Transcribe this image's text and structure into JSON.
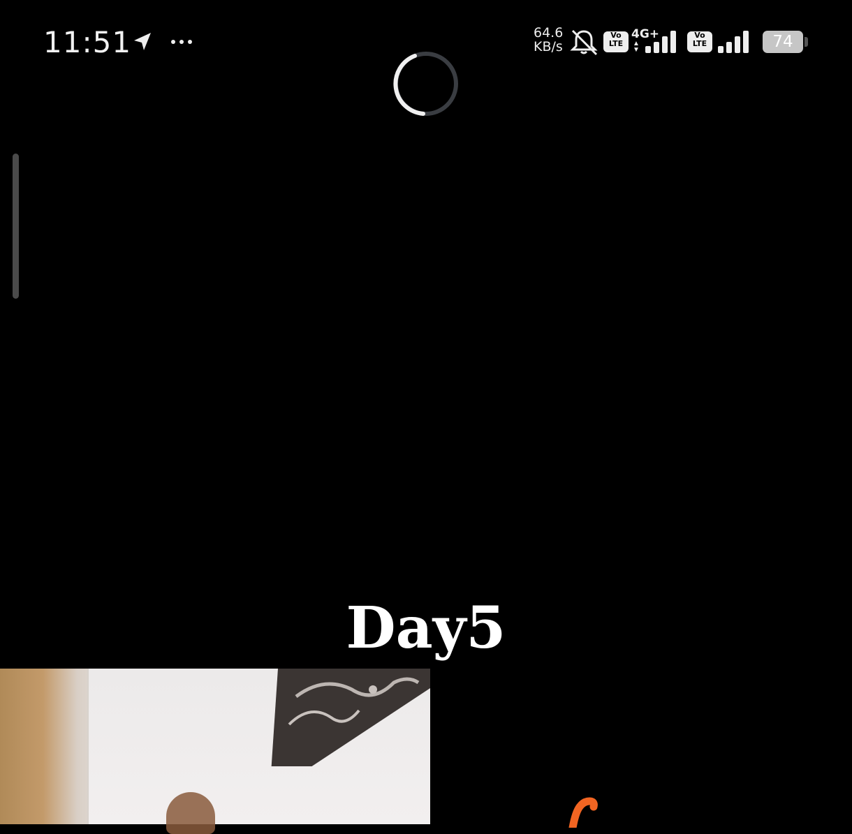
{
  "status_bar": {
    "time": "11:51",
    "net_speed_value": "64.6",
    "net_speed_unit": "KB/s",
    "volte_top": "Vo",
    "volte_bottom": "LTE",
    "network_type": "4G+",
    "battery_level": "74",
    "icons": [
      "navigation-icon",
      "more-dots-icon",
      "mute-bell-icon",
      "signal-icon",
      "battery-icon"
    ]
  },
  "loading": {
    "icon": "loading-spinner-icon"
  },
  "video": {
    "caption": "Day5"
  },
  "colors": {
    "background": "#000000",
    "accent_orange": "#f26522",
    "battery": "#c6c6c6"
  }
}
